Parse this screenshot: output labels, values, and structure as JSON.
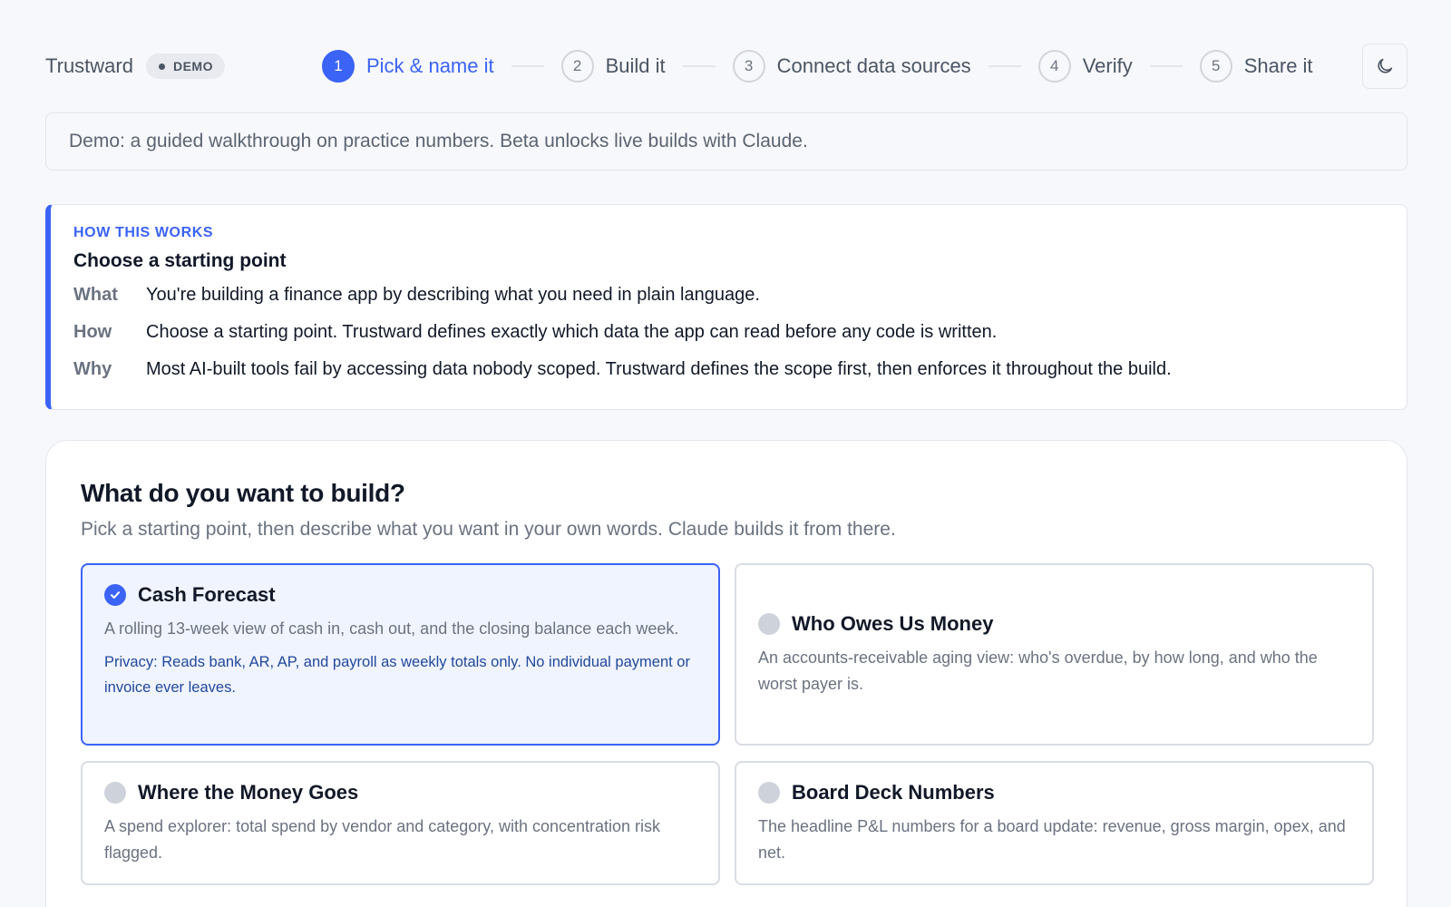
{
  "brand": {
    "name": "Trustward",
    "badge": "DEMO"
  },
  "stepper": [
    {
      "num": "1",
      "label": "Pick & name it",
      "active": true
    },
    {
      "num": "2",
      "label": "Build it",
      "active": false
    },
    {
      "num": "3",
      "label": "Connect data sources",
      "active": false
    },
    {
      "num": "4",
      "label": "Verify",
      "active": false
    },
    {
      "num": "5",
      "label": "Share it",
      "active": false
    }
  ],
  "theme_toggle": {
    "icon": "moon-icon"
  },
  "banner": {
    "text": "Demo: a guided walkthrough on practice numbers. Beta unlocks live builds with Claude."
  },
  "how": {
    "eyebrow": "HOW THIS WORKS",
    "title": "Choose a starting point",
    "rows": [
      {
        "key": "What",
        "value": "You're building a finance app by describing what you need in plain language."
      },
      {
        "key": "How",
        "value": "Choose a starting point. Trustward defines exactly which data the app can read before any code is written."
      },
      {
        "key": "Why",
        "value": "Most AI-built tools fail by accessing data nobody scoped. Trustward defines the scope first, then enforces it throughout the build."
      }
    ]
  },
  "build": {
    "title": "What do you want to build?",
    "subtitle": "Pick a starting point, then describe what you want in your own words. Claude builds it from there.",
    "options": [
      {
        "title": "Cash Forecast",
        "description": "A rolling 13-week view of cash in, cash out, and the closing balance each week.",
        "privacy": "Privacy: Reads bank, AR, AP, and payroll as weekly totals only. No individual payment or invoice ever leaves.",
        "selected": true
      },
      {
        "title": "Who Owes Us Money",
        "description": "An accounts-receivable aging view: who's overdue, by how long, and who the worst payer is.",
        "selected": false
      },
      {
        "title": "Where the Money Goes",
        "description": "A spend explorer: total spend by vendor and category, with concentration risk flagged.",
        "selected": false
      },
      {
        "title": "Board Deck Numbers",
        "description": "The headline P&L numbers for a board update: revenue, gross margin, opex, and net.",
        "selected": false
      }
    ]
  },
  "colors": {
    "accent": "#3b63f6",
    "selected_bg": "#f0f4ff",
    "privacy_text": "#22489c"
  }
}
